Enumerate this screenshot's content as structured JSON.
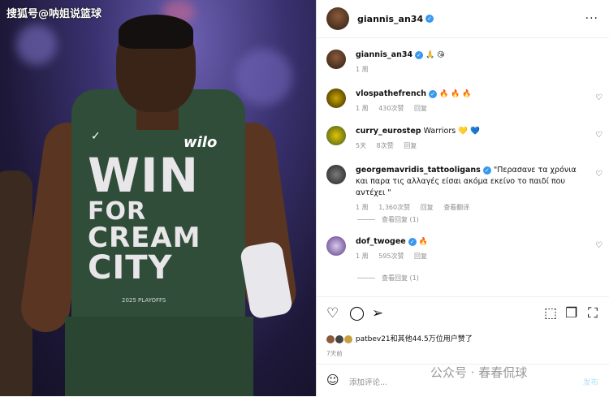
{
  "photo": {
    "watermark": "搜狐号@呐姐说篮球",
    "jersey_lines": [
      "WIN",
      "FOR",
      "CREAM",
      "CITY"
    ],
    "sponsor": "wilo",
    "playoffs_text": "2025 PLAYOFFS"
  },
  "header": {
    "username": "giannis_an34",
    "more": "···"
  },
  "caption": {
    "username": "giannis_an34",
    "emojis": "🙏 😘",
    "time": "1 周"
  },
  "comments": [
    {
      "username": "vlospathefrench",
      "text": "🔥 🔥 🔥",
      "time": "1 周",
      "likes": "430次赞",
      "reply": "回复"
    },
    {
      "username": "curry_eurostep",
      "text": "Warriors 💛 💙",
      "time": "5天",
      "likes": "8次赞",
      "reply": "回复"
    },
    {
      "username": "georgemavridis_tattooligans",
      "text": "\"Περασανε τα χρόνια και παρα τις αλλαγές είσαι ακόμα εκείνο το παιδί που αντέχει \"",
      "time": "1 周",
      "likes": "1,360次赞",
      "reply": "回复",
      "translate": "查看翻译",
      "view_replies": "查看回复 (1)"
    },
    {
      "username": "dof_twogee",
      "text": "🔥",
      "time": "1 周",
      "likes": "595次赞",
      "reply": "回复",
      "view_replies": "查看回复 (1)"
    }
  ],
  "likes_line": "patbev21和其他44.5万位用户赞了",
  "posted": "7天前",
  "add_comment": {
    "placeholder": "添加评论...",
    "post": "发布"
  },
  "overlay_watermark": "公众号 · 春春侃球"
}
